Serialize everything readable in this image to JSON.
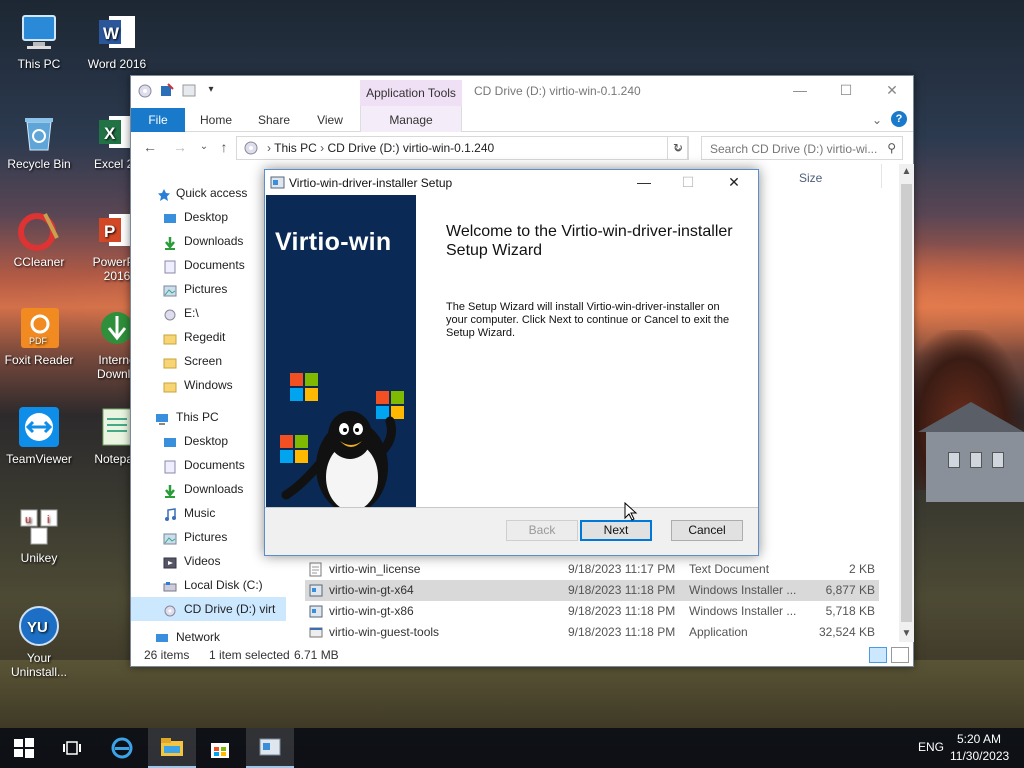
{
  "desktop": {
    "icons": [
      {
        "label": "This PC",
        "icon": "this-pc-icon"
      },
      {
        "label": "Word 2016",
        "icon": "word-icon"
      },
      {
        "label": "Recycle Bin",
        "icon": "recycle-bin-icon"
      },
      {
        "label": "Excel 20",
        "icon": "excel-icon"
      },
      {
        "label": "CCleaner",
        "icon": "ccleaner-icon"
      },
      {
        "label": "PowerPo 2016",
        "icon": "powerpoint-icon"
      },
      {
        "label": "Foxit Reader",
        "icon": "foxit-reader-icon"
      },
      {
        "label": "Interne Downlo",
        "icon": "internet-download-manager-icon"
      },
      {
        "label": "TeamViewer",
        "icon": "teamviewer-icon"
      },
      {
        "label": "Notepad",
        "icon": "notepad-icon"
      },
      {
        "label": "Unikey",
        "icon": "unikey-icon"
      },
      {
        "label": "Your Uninstall...",
        "icon": "your-uninstaller-icon"
      }
    ]
  },
  "explorer": {
    "title": "CD Drive (D:) virtio-win-0.1.240",
    "app_tools_label": "Application Tools",
    "ribbon_tabs": {
      "file": "File",
      "home": "Home",
      "share": "Share",
      "view": "View",
      "manage": "Manage"
    },
    "address": {
      "root": "This PC",
      "path": "CD Drive (D:) virtio-win-0.1.240"
    },
    "search_placeholder": "Search CD Drive (D:) virtio-wi...",
    "nav": {
      "quick_access": "Quick access",
      "qa_items": [
        "Desktop",
        "Downloads",
        "Documents",
        "Pictures",
        "E:\\",
        "Regedit",
        "Screen",
        "Windows"
      ],
      "this_pc": "This PC",
      "pc_items": [
        "Desktop",
        "Documents",
        "Downloads",
        "Music",
        "Pictures",
        "Videos",
        "Local Disk (C:)",
        "CD Drive (D:) virt"
      ],
      "network": "Network"
    },
    "column_size": "Size",
    "files": [
      {
        "name": "virtio-win_license",
        "date": "9/18/2023 11:17 PM",
        "type": "Text Document",
        "size": "2 KB"
      },
      {
        "name": "virtio-win-gt-x64",
        "date": "9/18/2023 11:18 PM",
        "type": "Windows Installer ...",
        "size": "6,877 KB"
      },
      {
        "name": "virtio-win-gt-x86",
        "date": "9/18/2023 11:18 PM",
        "type": "Windows Installer ...",
        "size": "5,718 KB"
      },
      {
        "name": "virtio-win-guest-tools",
        "date": "9/18/2023 11:18 PM",
        "type": "Application",
        "size": "32,524 KB"
      }
    ],
    "status": {
      "items": "26 items",
      "selected": "1 item selected",
      "size": "6.71 MB"
    }
  },
  "setup": {
    "title": "Virtio-win-driver-installer Setup",
    "brand": "Virtio-win",
    "heading": "Welcome to the Virtio-win-driver-installer Setup Wizard",
    "body": "The Setup Wizard will install Virtio-win-driver-installer on your computer. Click Next to continue or Cancel to exit the Setup Wizard.",
    "buttons": {
      "back": "Back",
      "next": "Next",
      "cancel": "Cancel"
    }
  },
  "taskbar": {
    "language": "ENG",
    "time": "5:20 AM",
    "date": "11/30/2023"
  }
}
